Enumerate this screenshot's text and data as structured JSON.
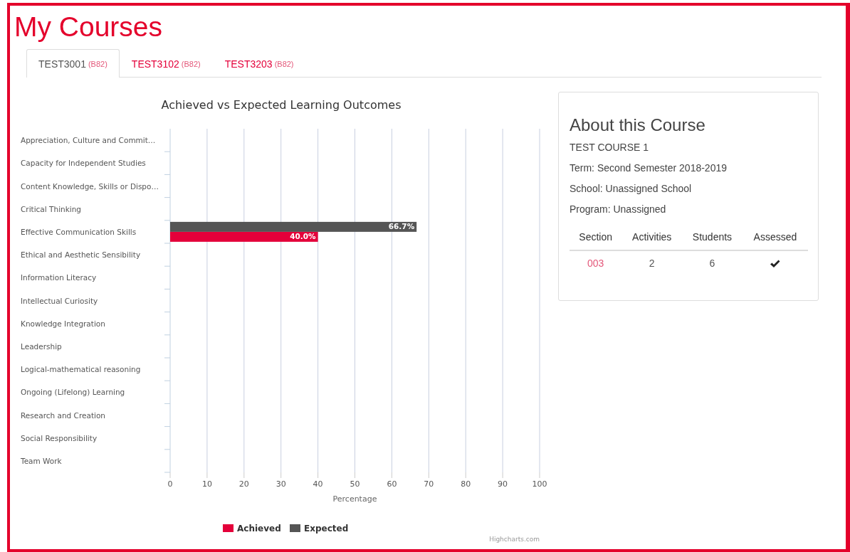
{
  "page_title": "My Courses",
  "tabs": [
    {
      "code": "TEST3001",
      "group": "(B82)",
      "selected": true
    },
    {
      "code": "TEST3102",
      "group": "(B82)",
      "selected": false
    },
    {
      "code": "TEST3203",
      "group": "(B82)",
      "selected": false
    }
  ],
  "chart": {
    "chart_data": {
      "type": "bar",
      "orientation": "horizontal",
      "title": "Achieved vs Expected Learning Outcomes",
      "xlabel": "Percentage",
      "categories": [
        "Appreciation, Culture and Commit…",
        "Capacity for Independent Studies",
        "Content Knowledge, Skills or Dispo…",
        "Critical Thinking",
        "Effective Communication Skills",
        "Ethical and Aesthetic Sensibility",
        "Information Literacy",
        "Intellectual Curiosity",
        "Knowledge Integration",
        "Leadership",
        "Logical-mathematical reasoning",
        "Ongoing (Lifelong) Learning",
        "Research and Creation",
        "Social Responsibility",
        "Team Work"
      ],
      "series": [
        {
          "name": "Achieved",
          "color": "#e4003a",
          "values": [
            null,
            null,
            null,
            null,
            40.0,
            null,
            null,
            null,
            null,
            null,
            null,
            null,
            null,
            null,
            null
          ],
          "value_labels": [
            null,
            null,
            null,
            null,
            "40.0%",
            null,
            null,
            null,
            null,
            null,
            null,
            null,
            null,
            null,
            null
          ]
        },
        {
          "name": "Expected",
          "color": "#555555",
          "values": [
            null,
            null,
            null,
            null,
            66.7,
            null,
            null,
            null,
            null,
            null,
            null,
            null,
            null,
            null,
            null
          ],
          "value_labels": [
            null,
            null,
            null,
            null,
            "66.7%",
            null,
            null,
            null,
            null,
            null,
            null,
            null,
            null,
            null,
            null
          ]
        }
      ],
      "xlim": [
        0,
        100
      ],
      "xticks": [
        0,
        10,
        20,
        30,
        40,
        50,
        60,
        70,
        80,
        90,
        100
      ],
      "data_labels": true,
      "legend": true,
      "grid": true
    },
    "credits": "Highcharts.com"
  },
  "about": {
    "heading": "About this Course",
    "lines": [
      "TEST COURSE 1",
      "Term: Second Semester 2018-2019",
      "School: Unassigned School",
      "Program: Unassigned"
    ],
    "table": {
      "columns": [
        "Section",
        "Activities",
        "Students",
        "Assessed"
      ],
      "rows": [
        {
          "section": "003",
          "activities": "2",
          "students": "6",
          "assessed": true
        }
      ]
    }
  }
}
